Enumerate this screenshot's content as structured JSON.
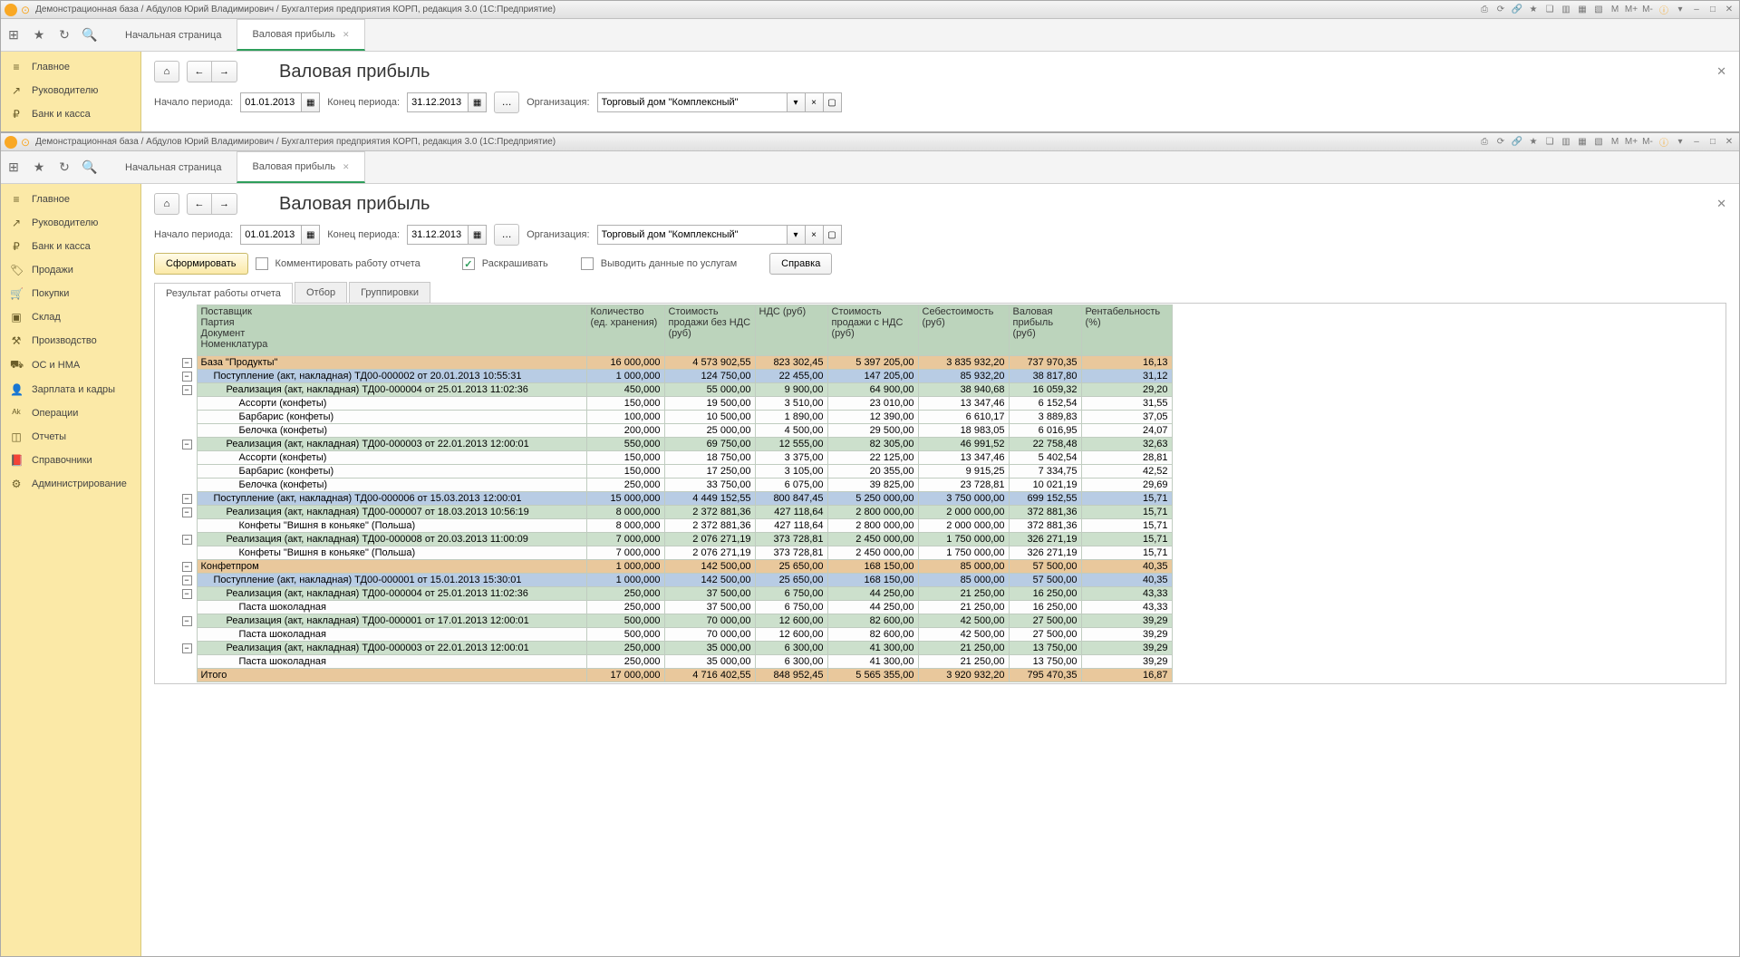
{
  "titlebar": {
    "title": "Демонстрационная база / Абдулов Юрий Владимирович / Бухгалтерия предприятия КОРП, редакция 3.0  (1С:Предприятие)"
  },
  "tabs": {
    "start": "Начальная страница",
    "report": "Валовая прибыль"
  },
  "sidebar": [
    {
      "icon": "≡",
      "label": "Главное"
    },
    {
      "icon": "↗",
      "label": "Руководителю"
    },
    {
      "icon": "₽",
      "label": "Банк и касса"
    }
  ],
  "sidebar2": [
    {
      "icon": "≡",
      "label": "Главное"
    },
    {
      "icon": "↗",
      "label": "Руководителю"
    },
    {
      "icon": "₽",
      "label": "Банк и касса"
    },
    {
      "icon": "🏷",
      "label": "Продажи"
    },
    {
      "icon": "🛒",
      "label": "Покупки"
    },
    {
      "icon": "▣",
      "label": "Склад"
    },
    {
      "icon": "⚒",
      "label": "Производство"
    },
    {
      "icon": "⛟",
      "label": "ОС и НМА"
    },
    {
      "icon": "👤",
      "label": "Зарплата и кадры"
    },
    {
      "icon": "ᴬᵏ",
      "label": "Операции"
    },
    {
      "icon": "◫",
      "label": "Отчеты"
    },
    {
      "icon": "📕",
      "label": "Справочники"
    },
    {
      "icon": "⚙",
      "label": "Администрирование"
    }
  ],
  "page": {
    "title": "Валовая прибыль",
    "start_label": "Начало периода:",
    "start_value": "01.01.2013",
    "end_label": "Конец периода:",
    "end_value": "31.12.2013",
    "org_label": "Организация:",
    "org_value": "Торговый дом \"Комплексный\"",
    "form_btn": "Сформировать",
    "comment_chk": "Комментировать работу отчета",
    "color_chk": "Раскрашивать",
    "services_chk": "Выводить данные по услугам",
    "help_btn": "Справка"
  },
  "subtabs": [
    "Результат работы отчета",
    "Отбор",
    "Группировки"
  ],
  "columns": {
    "c0": "Поставщик\nПартия\nДокумент\nНоменклатура",
    "c1": "Количество (ед. хранения)",
    "c2": "Стоимость продажи без НДС (руб)",
    "c3": "НДС (руб)",
    "c4": "Стоимость продажи с НДС (руб)",
    "c5": "Себестоимость (руб)",
    "c6": "Валовая прибыль (руб)",
    "c7": "Рентабельность (%)"
  },
  "rows": [
    {
      "lvl": 0,
      "t": 1,
      "name": "База \"Продукты\"",
      "v": [
        "16 000,000",
        "4 573 902,55",
        "823 302,45",
        "5 397 205,00",
        "3 835 932,20",
        "737 970,35",
        "16,13"
      ]
    },
    {
      "lvl": 1,
      "t": 1,
      "name": "Поступление (акт, накладная) ТД00-000002 от 20.01.2013 10:55:31",
      "v": [
        "1 000,000",
        "124 750,00",
        "22 455,00",
        "147 205,00",
        "85 932,20",
        "38 817,80",
        "31,12"
      ]
    },
    {
      "lvl": 2,
      "t": 1,
      "name": "Реализация (акт, накладная) ТД00-000004 от 25.01.2013 11:02:36",
      "v": [
        "450,000",
        "55 000,00",
        "9 900,00",
        "64 900,00",
        "38 940,68",
        "16 059,32",
        "29,20"
      ]
    },
    {
      "lvl": 3,
      "t": 0,
      "name": "Ассорти (конфеты)",
      "v": [
        "150,000",
        "19 500,00",
        "3 510,00",
        "23 010,00",
        "13 347,46",
        "6 152,54",
        "31,55"
      ]
    },
    {
      "lvl": 3,
      "t": 0,
      "name": "Барбарис (конфеты)",
      "v": [
        "100,000",
        "10 500,00",
        "1 890,00",
        "12 390,00",
        "6 610,17",
        "3 889,83",
        "37,05"
      ]
    },
    {
      "lvl": 3,
      "t": 0,
      "name": "Белочка (конфеты)",
      "v": [
        "200,000",
        "25 000,00",
        "4 500,00",
        "29 500,00",
        "18 983,05",
        "6 016,95",
        "24,07"
      ]
    },
    {
      "lvl": 2,
      "t": 1,
      "name": "Реализация (акт, накладная) ТД00-000003 от 22.01.2013 12:00:01",
      "v": [
        "550,000",
        "69 750,00",
        "12 555,00",
        "82 305,00",
        "46 991,52",
        "22 758,48",
        "32,63"
      ]
    },
    {
      "lvl": 3,
      "t": 0,
      "name": "Ассорти (конфеты)",
      "v": [
        "150,000",
        "18 750,00",
        "3 375,00",
        "22 125,00",
        "13 347,46",
        "5 402,54",
        "28,81"
      ]
    },
    {
      "lvl": 3,
      "t": 0,
      "name": "Барбарис (конфеты)",
      "v": [
        "150,000",
        "17 250,00",
        "3 105,00",
        "20 355,00",
        "9 915,25",
        "7 334,75",
        "42,52"
      ]
    },
    {
      "lvl": 3,
      "t": 0,
      "name": "Белочка (конфеты)",
      "v": [
        "250,000",
        "33 750,00",
        "6 075,00",
        "39 825,00",
        "23 728,81",
        "10 021,19",
        "29,69"
      ]
    },
    {
      "lvl": 1,
      "t": 1,
      "name": "Поступление (акт, накладная) ТД00-000006 от 15.03.2013 12:00:01",
      "v": [
        "15 000,000",
        "4 449 152,55",
        "800 847,45",
        "5 250 000,00",
        "3 750 000,00",
        "699 152,55",
        "15,71"
      ]
    },
    {
      "lvl": 2,
      "t": 1,
      "name": "Реализация (акт, накладная) ТД00-000007 от 18.03.2013 10:56:19",
      "v": [
        "8 000,000",
        "2 372 881,36",
        "427 118,64",
        "2 800 000,00",
        "2 000 000,00",
        "372 881,36",
        "15,71"
      ]
    },
    {
      "lvl": 3,
      "t": 0,
      "name": "Конфеты \"Вишня в коньяке\" (Польша)",
      "v": [
        "8 000,000",
        "2 372 881,36",
        "427 118,64",
        "2 800 000,00",
        "2 000 000,00",
        "372 881,36",
        "15,71"
      ]
    },
    {
      "lvl": 2,
      "t": 1,
      "name": "Реализация (акт, накладная) ТД00-000008 от 20.03.2013 11:00:09",
      "v": [
        "7 000,000",
        "2 076 271,19",
        "373 728,81",
        "2 450 000,00",
        "1 750 000,00",
        "326 271,19",
        "15,71"
      ]
    },
    {
      "lvl": 3,
      "t": 0,
      "name": "Конфеты \"Вишня в коньяке\" (Польша)",
      "v": [
        "7 000,000",
        "2 076 271,19",
        "373 728,81",
        "2 450 000,00",
        "1 750 000,00",
        "326 271,19",
        "15,71"
      ]
    },
    {
      "lvl": 0,
      "t": 1,
      "name": "Конфетпром",
      "v": [
        "1 000,000",
        "142 500,00",
        "25 650,00",
        "168 150,00",
        "85 000,00",
        "57 500,00",
        "40,35"
      ]
    },
    {
      "lvl": 1,
      "t": 1,
      "name": "Поступление (акт, накладная) ТД00-000001 от 15.01.2013 15:30:01",
      "v": [
        "1 000,000",
        "142 500,00",
        "25 650,00",
        "168 150,00",
        "85 000,00",
        "57 500,00",
        "40,35"
      ]
    },
    {
      "lvl": 2,
      "t": 1,
      "name": "Реализация (акт, накладная) ТД00-000004 от 25.01.2013 11:02:36",
      "v": [
        "250,000",
        "37 500,00",
        "6 750,00",
        "44 250,00",
        "21 250,00",
        "16 250,00",
        "43,33"
      ]
    },
    {
      "lvl": 3,
      "t": 0,
      "name": "Паста шоколадная",
      "v": [
        "250,000",
        "37 500,00",
        "6 750,00",
        "44 250,00",
        "21 250,00",
        "16 250,00",
        "43,33"
      ]
    },
    {
      "lvl": 2,
      "t": 1,
      "name": "Реализация (акт, накладная) ТД00-000001 от 17.01.2013 12:00:01",
      "v": [
        "500,000",
        "70 000,00",
        "12 600,00",
        "82 600,00",
        "42 500,00",
        "27 500,00",
        "39,29"
      ]
    },
    {
      "lvl": 3,
      "t": 0,
      "name": "Паста шоколадная",
      "v": [
        "500,000",
        "70 000,00",
        "12 600,00",
        "82 600,00",
        "42 500,00",
        "27 500,00",
        "39,29"
      ]
    },
    {
      "lvl": 2,
      "t": 1,
      "name": "Реализация (акт, накладная) ТД00-000003 от 22.01.2013 12:00:01",
      "v": [
        "250,000",
        "35 000,00",
        "6 300,00",
        "41 300,00",
        "21 250,00",
        "13 750,00",
        "39,29"
      ]
    },
    {
      "lvl": 3,
      "t": 0,
      "name": "Паста шоколадная",
      "v": [
        "250,000",
        "35 000,00",
        "6 300,00",
        "41 300,00",
        "21 250,00",
        "13 750,00",
        "39,29"
      ]
    }
  ],
  "total": {
    "name": "Итого",
    "v": [
      "17 000,000",
      "4 716 402,55",
      "848 952,45",
      "5 565 355,00",
      "3 920 932,20",
      "795 470,35",
      "16,87"
    ]
  }
}
